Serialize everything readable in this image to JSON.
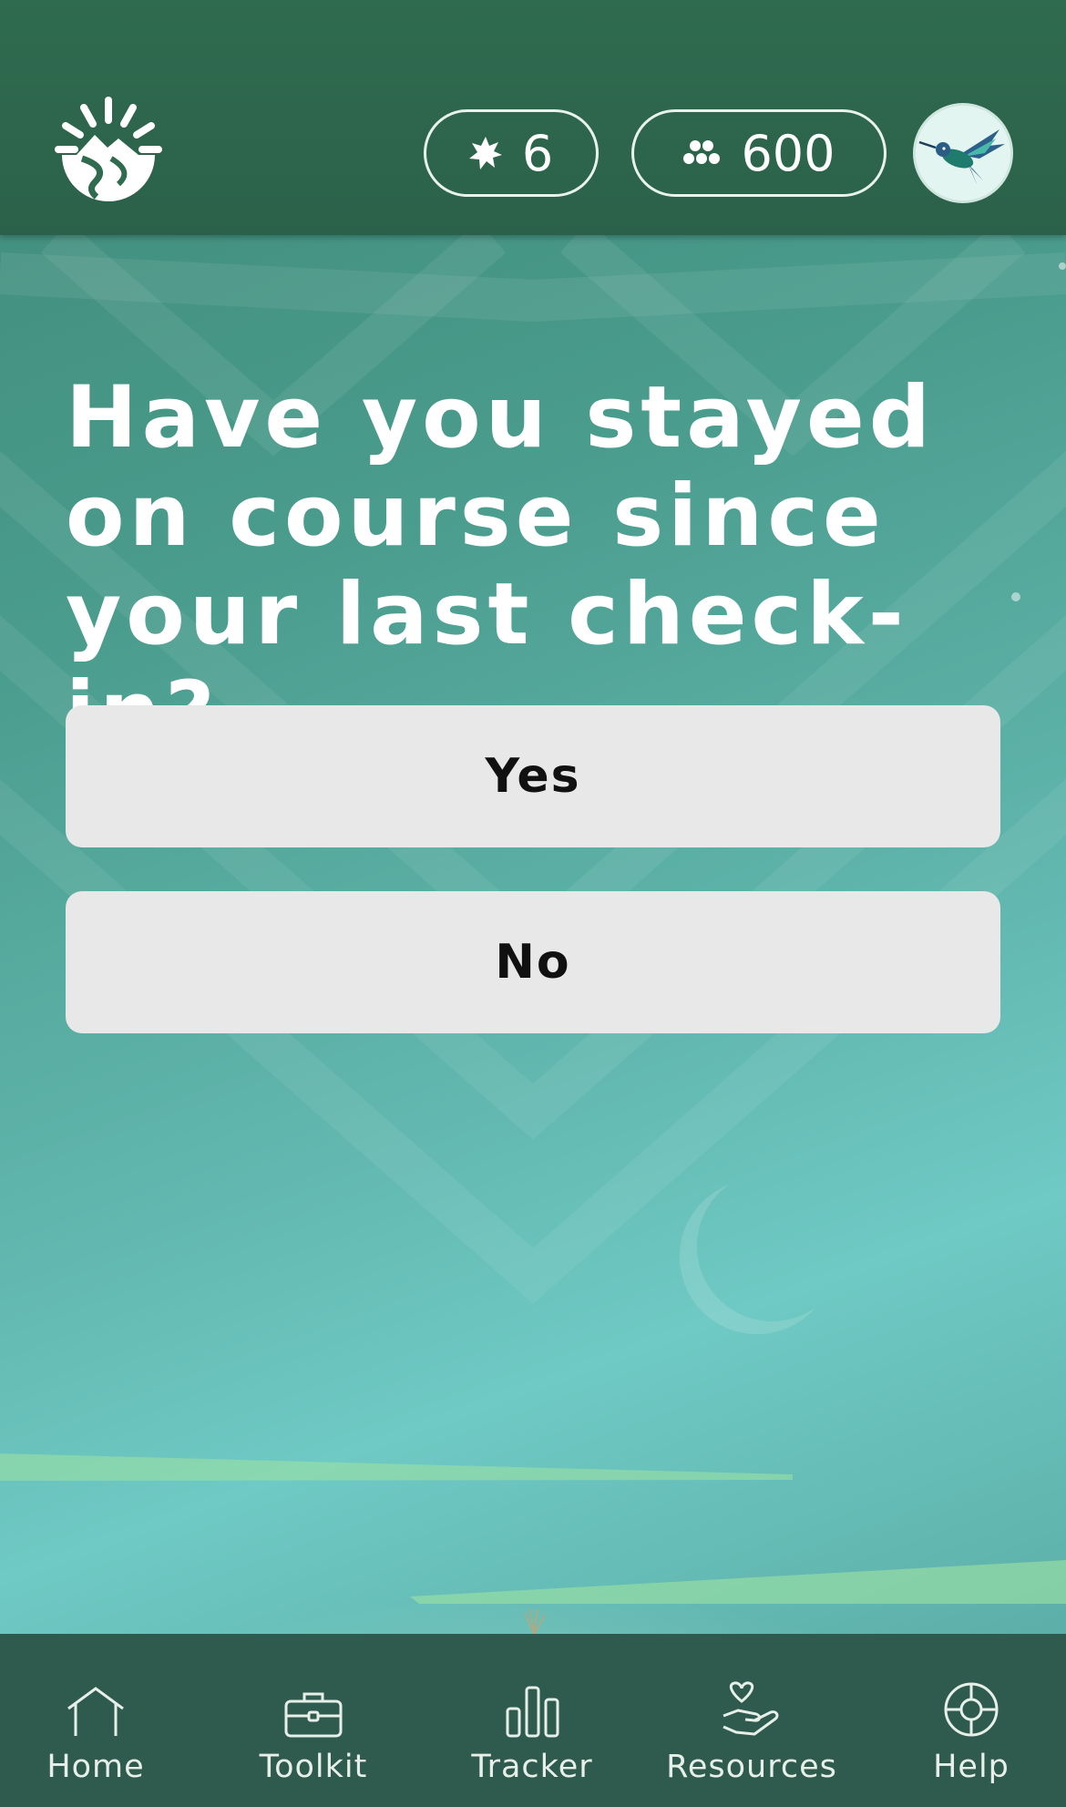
{
  "header": {
    "logo_icon": "sun-mountain-logo-icon",
    "streak": {
      "icon": "star-burst-icon",
      "value": "6"
    },
    "points": {
      "icon": "dots-cluster-icon",
      "value": "600"
    },
    "avatar_icon": "hummingbird-avatar-icon"
  },
  "main": {
    "question": "Have you stayed on course since your last check-in?",
    "answers": [
      {
        "label": "Yes"
      },
      {
        "label": "No"
      }
    ]
  },
  "bottom_nav": {
    "items": [
      {
        "label": "Home",
        "icon": "home-icon"
      },
      {
        "label": "Toolkit",
        "icon": "toolkit-icon"
      },
      {
        "label": "Tracker",
        "icon": "tracker-icon"
      },
      {
        "label": "Resources",
        "icon": "resources-icon"
      },
      {
        "label": "Help",
        "icon": "help-icon"
      }
    ]
  },
  "colors": {
    "header_bg": "#2f6b4f",
    "nav_bg": "#2f5a4e",
    "button_bg": "#e8e8e8",
    "text_light": "#ffffff"
  }
}
